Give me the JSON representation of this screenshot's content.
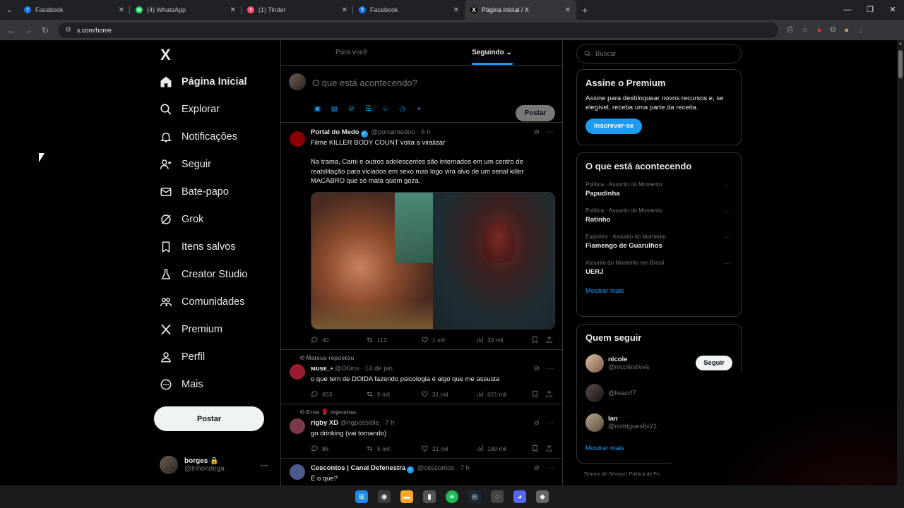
{
  "browser": {
    "tabs": [
      {
        "title": "Facebook",
        "color": "#1877f2",
        "icon": "f"
      },
      {
        "title": "(4) WhatsApp",
        "color": "#25d366",
        "icon": "w"
      },
      {
        "title": "(1) Tinder",
        "color": "#fd5068",
        "icon": "t"
      },
      {
        "title": "Facebook",
        "color": "#1877f2",
        "icon": "f"
      },
      {
        "title": "Página Inicial / X",
        "color": "#000000",
        "icon": "X"
      }
    ],
    "url": "x.com/home"
  },
  "nav": {
    "logo": "X",
    "items": [
      {
        "label": "Página Inicial",
        "icon": "home-icon"
      },
      {
        "label": "Explorar",
        "icon": "search-icon"
      },
      {
        "label": "Notificações",
        "icon": "bell-icon"
      },
      {
        "label": "Seguir",
        "icon": "add-user-icon"
      },
      {
        "label": "Bate-papo",
        "icon": "mail-icon"
      },
      {
        "label": "Grok",
        "icon": "grok-icon"
      },
      {
        "label": "Itens salvos",
        "icon": "bookmark-icon"
      },
      {
        "label": "Creator Studio",
        "icon": "flask-icon"
      },
      {
        "label": "Comunidades",
        "icon": "people-icon"
      },
      {
        "label": "Premium",
        "icon": "x-icon"
      },
      {
        "label": "Perfil",
        "icon": "person-icon"
      },
      {
        "label": "Mais",
        "icon": "more-circle-icon"
      }
    ],
    "post_label": "Postar",
    "profile": {
      "name": "borges 🔒",
      "handle": "@lnhondega"
    }
  },
  "feed": {
    "tabs": [
      "Para você",
      "Seguindo"
    ],
    "composer": {
      "placeholder": "O que está acontecendo?",
      "post_label": "Postar"
    },
    "tweets": [
      {
        "author": "Portal do Medo",
        "handle": "@portalmedoo",
        "time": "6 h",
        "line1": "Filme KILLER BODY COUNT volta a viralizar",
        "line2": "Na trama, Cami e outros adolescentes são internados em um centro de reabilitação para viciados em sexo mas logo vira alvo de um serial killer MACABRO que só mata quem goza.",
        "stats": {
          "replies": "40",
          "reposts": "112",
          "likes": "1 mil",
          "views": "32 mil"
        }
      },
      {
        "repost_by": "Mateus repostou",
        "author": "ᴍᴜsᴇ_▪",
        "handle": "@O6ios",
        "time": "14 de jan",
        "text": "o que tem de DOIDA fazendo psicologia é algo que me assusta",
        "stats": {
          "replies": "653",
          "reposts": "5 mil",
          "likes": "31 mil",
          "views": "621 mil"
        }
      },
      {
        "repost_by": "Eros 🌹 repostou",
        "author": "rigby XD",
        "handle": "@rigpossible",
        "time": "7 h",
        "text": "go drinking (vai tomando)",
        "stats": {
          "replies": "86",
          "reposts": "5 mil",
          "likes": "21 mil",
          "views": "180 mil"
        }
      },
      {
        "author": "Cescontos | Canal Defenestra",
        "handle": "@cescontos",
        "time": "7 h",
        "text": "É o que?"
      }
    ]
  },
  "sidebar": {
    "search_placeholder": "Buscar",
    "premium": {
      "title": "Assine o Premium",
      "text": "Assine para desbloquear novos recursos e, se elegível, receba uma parte da receita.",
      "button": "Inscrever-se"
    },
    "trends": {
      "title": "O que está acontecendo",
      "items": [
        {
          "context": "Política · Assunto do Momento",
          "title": "Papudinha"
        },
        {
          "context": "Política · Assunto do Momento",
          "title": "Ratinho"
        },
        {
          "context": "Esportes · Assunto do Momento",
          "title": "Flamengo de Guarulhos"
        },
        {
          "context": "Assunto do Momento em Brasil",
          "title": "UERJ"
        }
      ],
      "show_more": "Mostrar mais"
    },
    "who_to_follow": {
      "title": "Quem seguir",
      "items": [
        {
          "name": "nicole",
          "handle": "@nicoleslivva",
          "button": "Seguir"
        },
        {
          "name": "",
          "handle": "@lisacrf7"
        },
        {
          "name": "Ian",
          "handle": "@rodriguesfjv21"
        }
      ],
      "show_more": "Mostrar mais"
    },
    "footer": "Termos de Serviço | Política de Pri"
  },
  "colors": {
    "accent": "#1d9bf0",
    "background": "#000000",
    "border": "#2f3336",
    "muted": "#71767b"
  }
}
